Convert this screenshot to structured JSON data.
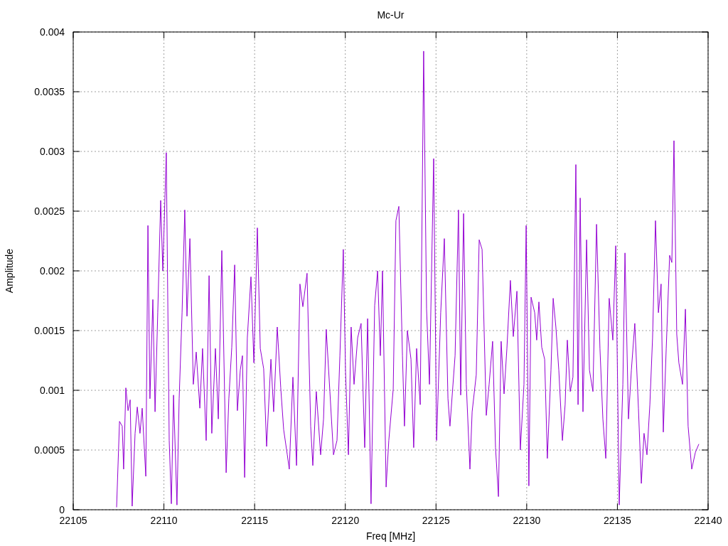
{
  "plot": {
    "chart_data": {
      "type": "line",
      "title": "Mc-Ur",
      "xlabel": "Freq [MHz]",
      "ylabel": "Amplitude",
      "grid": true,
      "xlim": [
        22105,
        22140
      ],
      "ylim": [
        0,
        0.004
      ],
      "xticks": [
        22105,
        22110,
        22115,
        22120,
        22125,
        22130,
        22135,
        22140
      ],
      "yticks": [
        0,
        0.0005,
        0.001,
        0.0015,
        0.002,
        0.0025,
        0.003,
        0.0035,
        0.004
      ],
      "x": [
        22107.39,
        22107.55,
        22107.7,
        22107.78,
        22107.9,
        22108.02,
        22108.14,
        22108.25,
        22108.41,
        22108.53,
        22108.68,
        22108.8,
        22109.0,
        22109.12,
        22109.23,
        22109.39,
        22109.51,
        22109.66,
        22109.82,
        22109.94,
        22110.13,
        22110.29,
        22110.41,
        22110.53,
        22110.72,
        22110.84,
        22111.0,
        22111.15,
        22111.27,
        22111.43,
        22111.62,
        22111.78,
        22111.98,
        22112.13,
        22112.33,
        22112.49,
        22112.64,
        22112.84,
        22113.0,
        22113.19,
        22113.43,
        22113.58,
        22113.74,
        22113.9,
        22114.05,
        22114.21,
        22114.33,
        22114.45,
        22114.6,
        22114.8,
        22114.96,
        22115.15,
        22115.31,
        22115.5,
        22115.66,
        22115.9,
        22116.05,
        22116.25,
        22116.44,
        22116.6,
        22116.8,
        22116.91,
        22117.11,
        22117.31,
        22117.5,
        22117.66,
        22117.89,
        22118.09,
        22118.21,
        22118.4,
        22118.64,
        22118.8,
        22118.95,
        22119.15,
        22119.35,
        22119.54,
        22119.7,
        22119.89,
        22120.01,
        22120.17,
        22120.32,
        22120.48,
        22120.68,
        22120.87,
        22121.07,
        22121.23,
        22121.42,
        22121.62,
        22121.78,
        22121.93,
        22122.05,
        22122.25,
        22122.4,
        22122.64,
        22122.79,
        22122.95,
        22123.15,
        22123.26,
        22123.42,
        22123.62,
        22123.77,
        22123.93,
        22124.13,
        22124.32,
        22124.48,
        22124.64,
        22124.87,
        22125.03,
        22125.26,
        22125.46,
        22125.66,
        22125.77,
        22126.05,
        22126.24,
        22126.36,
        22126.52,
        22126.67,
        22126.87,
        22126.99,
        22127.22,
        22127.38,
        22127.54,
        22127.77,
        22127.93,
        22128.12,
        22128.28,
        22128.44,
        22128.59,
        22128.75,
        22128.91,
        22129.1,
        22129.26,
        22129.46,
        22129.65,
        22129.85,
        22129.97,
        22130.12,
        22130.24,
        22130.44,
        22130.55,
        22130.67,
        22130.83,
        22130.99,
        22131.14,
        22131.34,
        22131.46,
        22131.61,
        22131.77,
        22131.97,
        22132.12,
        22132.24,
        22132.4,
        22132.55,
        22132.71,
        22132.83,
        22132.95,
        22133.1,
        22133.3,
        22133.46,
        22133.65,
        22133.85,
        22134.04,
        22134.2,
        22134.36,
        22134.55,
        22134.75,
        22134.91,
        22135.1,
        22135.3,
        22135.42,
        22135.61,
        22135.77,
        22135.96,
        22136.16,
        22136.32,
        22136.47,
        22136.63,
        22136.79,
        22136.94,
        22137.1,
        22137.26,
        22137.41,
        22137.53,
        22137.69,
        22137.88,
        22138.0,
        22138.12,
        22138.27,
        22138.39,
        22138.59,
        22138.75,
        22138.9,
        22139.1,
        22139.3,
        22139.49
      ],
      "series": [
        {
          "color": "#9400d3",
          "values": [
            2e-05,
            0.00074,
            0.0007,
            0.00034,
            0.00102,
            0.00083,
            0.00092,
            3e-05,
            0.00064,
            0.00086,
            0.00064,
            0.00085,
            0.00028,
            0.00238,
            0.00093,
            0.00176,
            0.00082,
            0.00165,
            0.00259,
            0.002,
            0.00299,
            0.00058,
            5e-05,
            0.00096,
            4e-05,
            0.00093,
            0.00165,
            0.00251,
            0.00162,
            0.00227,
            0.00105,
            0.00132,
            0.00085,
            0.00135,
            0.00058,
            0.00196,
            0.00064,
            0.00135,
            0.00076,
            0.00217,
            0.00031,
            0.00093,
            0.00136,
            0.00205,
            0.00083,
            0.00117,
            0.00129,
            0.00027,
            0.00144,
            0.00195,
            0.00123,
            0.00236,
            0.00135,
            0.00118,
            0.00053,
            0.00126,
            0.00082,
            0.00153,
            0.00102,
            0.00067,
            0.00046,
            0.00034,
            0.00111,
            0.00037,
            0.00189,
            0.0017,
            0.00198,
            0.0007,
            0.00037,
            0.00099,
            0.00046,
            0.00076,
            0.00151,
            0.00099,
            0.00046,
            0.00058,
            0.00129,
            0.00218,
            0.00116,
            0.00046,
            0.00153,
            0.00105,
            0.00144,
            0.00156,
            0.00052,
            0.0016,
            5e-05,
            0.00171,
            0.002,
            0.00129,
            0.002,
            0.00019,
            0.00058,
            0.00101,
            0.00242,
            0.00254,
            0.00129,
            0.0007,
            0.0015,
            0.00126,
            0.00052,
            0.00135,
            0.00088,
            0.00384,
            0.00168,
            0.00105,
            0.00294,
            0.00058,
            0.00165,
            0.00227,
            0.00093,
            0.0007,
            0.00129,
            0.00251,
            0.00096,
            0.00248,
            0.00105,
            0.00034,
            0.00082,
            0.00113,
            0.00226,
            0.00218,
            0.00079,
            0.00105,
            0.00141,
            0.00052,
            0.00011,
            0.00141,
            0.00097,
            0.00135,
            0.00192,
            0.00145,
            0.00183,
            0.0005,
            0.00105,
            0.00238,
            0.0002,
            0.00178,
            0.00165,
            0.00142,
            0.00174,
            0.00136,
            0.00126,
            0.00043,
            0.00117,
            0.00177,
            0.00153,
            0.00117,
            0.00058,
            0.00088,
            0.00142,
            0.00099,
            0.00111,
            0.00289,
            0.00088,
            0.00261,
            0.00082,
            0.00226,
            0.00117,
            0.00099,
            0.00239,
            0.00135,
            0.00076,
            0.00043,
            0.00177,
            0.00142,
            0.00221,
            4e-05,
            0.00105,
            0.00215,
            0.00076,
            0.00117,
            0.00156,
            0.00085,
            0.00022,
            0.00064,
            0.00046,
            0.00088,
            0.00144,
            0.00242,
            0.00165,
            0.00189,
            0.00065,
            0.00135,
            0.00213,
            0.00207,
            0.00309,
            0.00147,
            0.00123,
            0.00105,
            0.00168,
            0.0007,
            0.00034,
            0.00048,
            0.00055
          ]
        }
      ]
    }
  }
}
